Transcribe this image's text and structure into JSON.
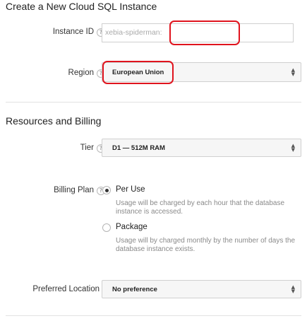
{
  "header": {
    "title": "Create a New Cloud SQL Instance"
  },
  "instance": {
    "label": "Instance ID",
    "prefix": "xebia-spiderman:",
    "value": ""
  },
  "region": {
    "label": "Region",
    "selected": "European Union"
  },
  "resources": {
    "title": "Resources and Billing"
  },
  "tier": {
    "label": "Tier",
    "selected": "D1 — 512M RAM"
  },
  "billing": {
    "label": "Billing Plan",
    "options": [
      {
        "label": "Per Use",
        "description": "Usage will be charged by each hour that the database instance is accessed.",
        "selected": true
      },
      {
        "label": "Package",
        "description": "Usage will by charged monthly by the number of days the database instance exists.",
        "selected": false
      }
    ]
  },
  "location": {
    "label": "Preferred Location",
    "selected": "No preference"
  },
  "icons": {
    "help": "help-circle-icon",
    "select_arrows": "select-arrows-icon"
  },
  "colors": {
    "highlight": "#e0141e",
    "divider": "#e2e2e2",
    "description": "#8a8a8a"
  }
}
